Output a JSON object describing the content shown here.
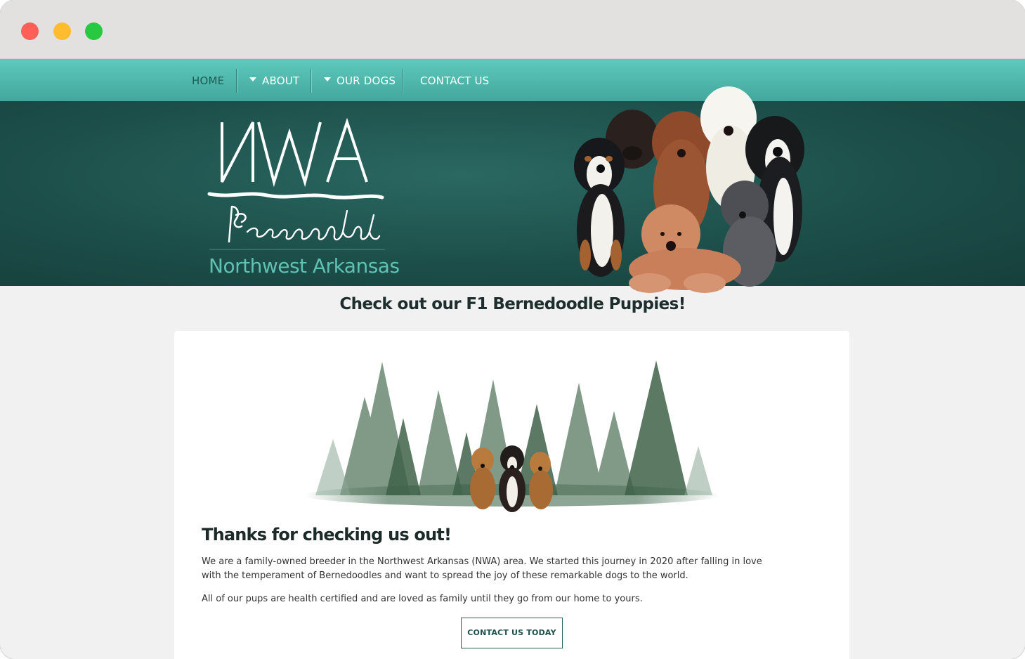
{
  "window": {
    "controls": [
      "close",
      "minimize",
      "maximize"
    ]
  },
  "nav": {
    "items": [
      {
        "label": "HOME",
        "has_dropdown": false,
        "active": true
      },
      {
        "label": "ABOUT",
        "has_dropdown": true,
        "active": false
      },
      {
        "label": "OUR DOGS",
        "has_dropdown": true,
        "active": false
      },
      {
        "label": "CONTACT US",
        "has_dropdown": false,
        "active": false
      }
    ]
  },
  "hero": {
    "logo_monogram": "NWA",
    "logo_script": "Bernedoodles",
    "logo_subtitle": "Northwest Arkansas"
  },
  "tagline": "Check out our F1 Bernedoodle Puppies!",
  "content": {
    "heading": "Thanks for checking us out!",
    "paragraphs": [
      "We are a family-owned breeder in the Northwest Arkansas (NWA) area. We started this journey in 2020 after falling in love with the temperament of Bernedoodles and want to spread the joy of these remarkable dogs to the world.",
      "All of our pups are health certified and are loved as family until they go from our home to yours."
    ],
    "cta_label": "CONTACT US TODAY"
  },
  "colors": {
    "nav_gradient_top": "#5ec9bd",
    "nav_gradient_bottom": "#43a79d",
    "hero_bg": "#1d4f4a",
    "logo_accent": "#5fc2b5",
    "page_bg": "#f1f1f1",
    "cta_border": "#2a5e59"
  }
}
